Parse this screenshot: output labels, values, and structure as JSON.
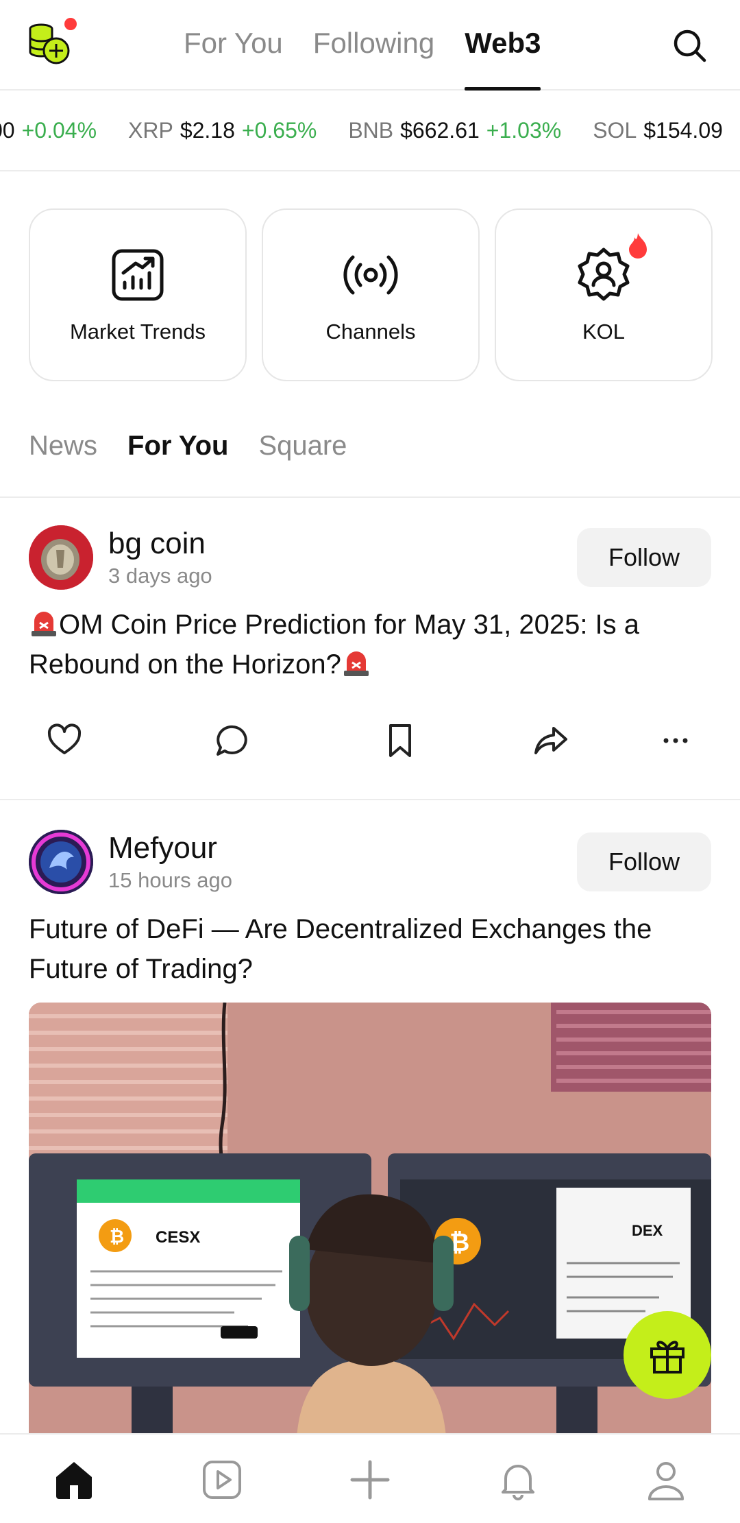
{
  "header": {
    "tabs": [
      {
        "label": "For You",
        "active": false
      },
      {
        "label": "Following",
        "active": false
      },
      {
        "label": "Web3",
        "active": true
      }
    ],
    "logo_icon": "coin-stack-icon",
    "search_icon": "search-icon"
  },
  "ticker": [
    {
      "symbol": "",
      "price": "00",
      "change": "+0.04%"
    },
    {
      "symbol": "XRP",
      "price": "$2.18",
      "change": "+0.65%"
    },
    {
      "symbol": "BNB",
      "price": "$662.61",
      "change": "+1.03%"
    },
    {
      "symbol": "SOL",
      "price": "$154.09",
      "change": ""
    }
  ],
  "cards": [
    {
      "label": "Market Trends",
      "icon": "chart-trend-icon"
    },
    {
      "label": "Channels",
      "icon": "broadcast-icon"
    },
    {
      "label": "KOL",
      "icon": "badge-user-icon",
      "hot": true
    }
  ],
  "sub_tabs": [
    {
      "label": "News",
      "active": false
    },
    {
      "label": "For You",
      "active": true
    },
    {
      "label": "Square",
      "active": false
    }
  ],
  "posts": [
    {
      "author": "bg coin",
      "time": "3 days ago",
      "follow_label": "Follow",
      "title_main": "OM Coin Price Prediction for May 31, 2025: Is a Rebound on the Horizon?"
    },
    {
      "author": "Mefyour",
      "time": "15 hours ago",
      "follow_label": "Follow",
      "title_main": "Future of DeFi — Are Decentralized Exchanges the Future of Trading?",
      "image_left_label": "CESX",
      "image_right_label": "DEX"
    }
  ],
  "colors": {
    "accent_green": "#3aae4e",
    "fab": "#c4ee1a",
    "notification_red": "#ff3b3b"
  }
}
